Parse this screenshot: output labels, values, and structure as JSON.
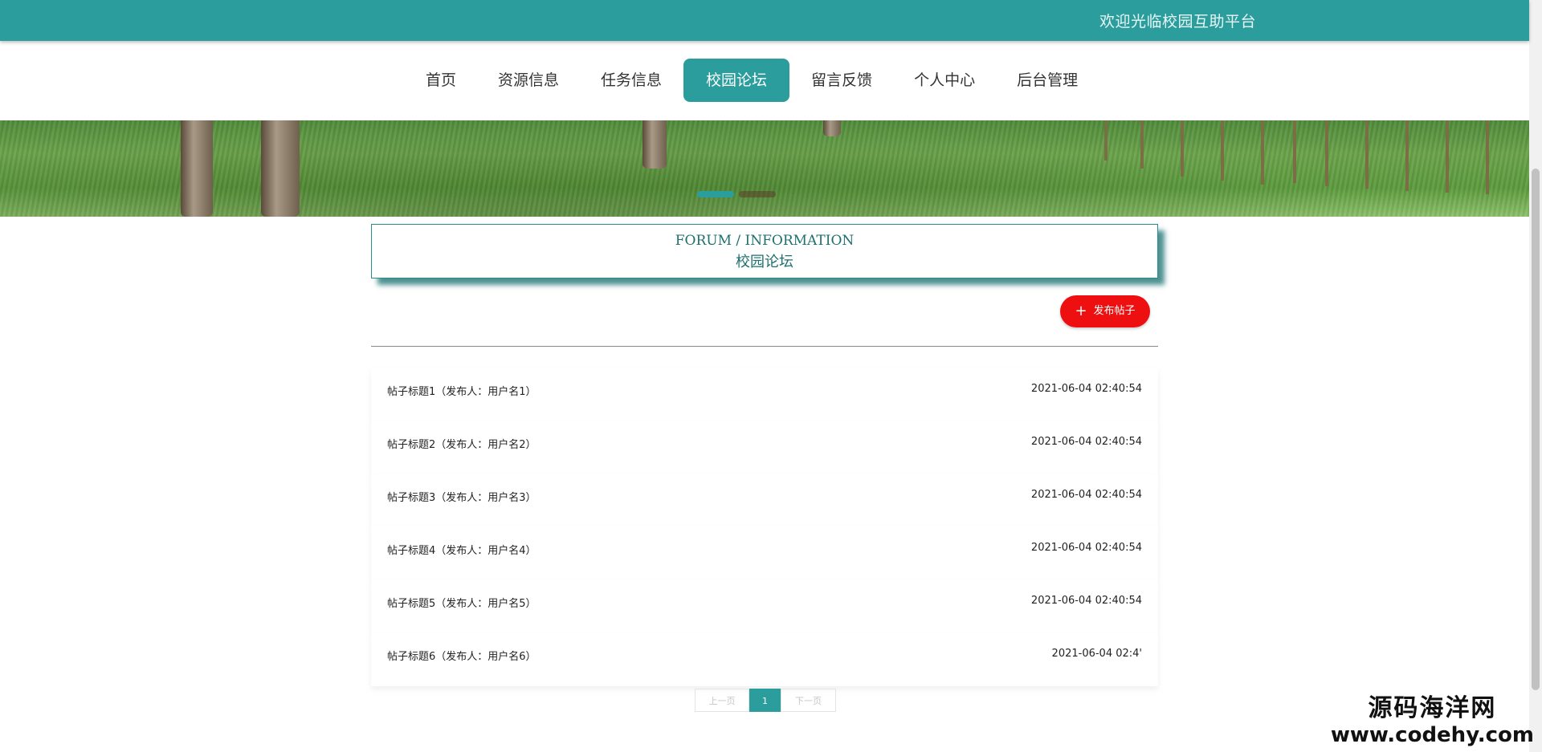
{
  "header": {
    "welcome": "欢迎光临校园互助平台"
  },
  "nav": {
    "items": [
      {
        "label": "首页"
      },
      {
        "label": "资源信息"
      },
      {
        "label": "任务信息"
      },
      {
        "label": "校园论坛",
        "active": true
      },
      {
        "label": "留言反馈"
      },
      {
        "label": "个人中心"
      },
      {
        "label": "后台管理"
      }
    ]
  },
  "section": {
    "title_en": "FORUM / INFORMATION",
    "title_cn": "校园论坛",
    "post_button": "发布帖子"
  },
  "posts": [
    {
      "title": "帖子标题1（发布人：用户名1）",
      "time": "2021-06-04 02:40:54"
    },
    {
      "title": "帖子标题2（发布人：用户名2）",
      "time": "2021-06-04 02:40:54"
    },
    {
      "title": "帖子标题3（发布人：用户名3）",
      "time": "2021-06-04 02:40:54"
    },
    {
      "title": "帖子标题4（发布人：用户名4）",
      "time": "2021-06-04 02:40:54"
    },
    {
      "title": "帖子标题5（发布人：用户名5）",
      "time": "2021-06-04 02:40:54"
    },
    {
      "title": "帖子标题6（发布人：用户名6）",
      "time": "2021-06-04 02:4'"
    }
  ],
  "pagination": {
    "prev": "上一页",
    "current": "1",
    "next": "下一页"
  },
  "watermark": {
    "line1": "源码海洋网",
    "line2": "www.codehy.com"
  },
  "colors": {
    "accent": "#2a9d9c",
    "post_button": "#ee1010"
  }
}
